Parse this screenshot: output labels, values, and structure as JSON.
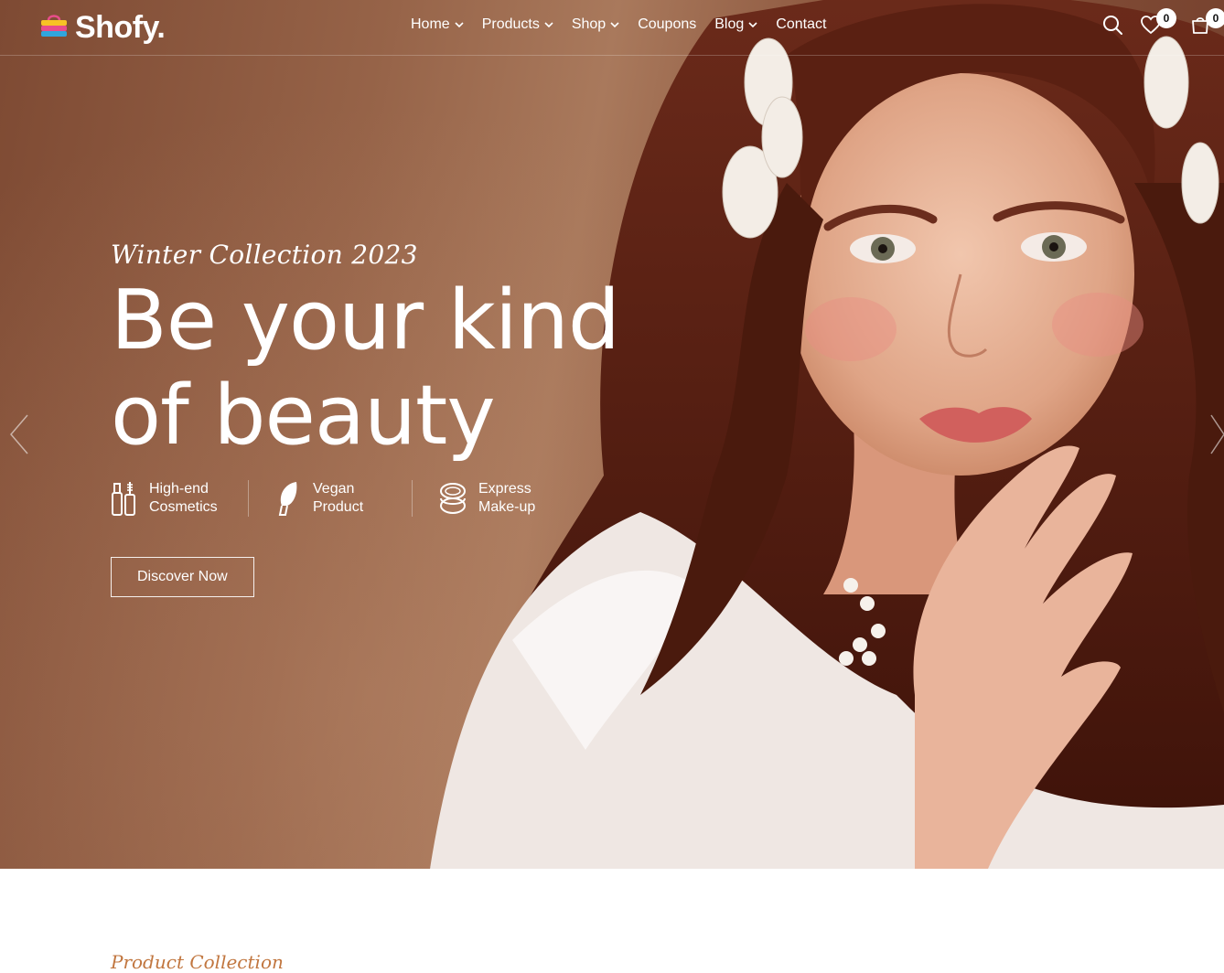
{
  "brand": {
    "name": "Shofy."
  },
  "nav": [
    {
      "label": "Home",
      "dropdown": true
    },
    {
      "label": "Products",
      "dropdown": true
    },
    {
      "label": "Shop",
      "dropdown": true
    },
    {
      "label": "Coupons",
      "dropdown": false
    },
    {
      "label": "Blog",
      "dropdown": true
    },
    {
      "label": "Contact",
      "dropdown": false
    }
  ],
  "header_icons": {
    "search": "search-icon",
    "wishlist_count": "0",
    "cart_count": "0"
  },
  "hero": {
    "subtitle": "Winter Collection 2023",
    "title_line1": "Be your kind",
    "title_line2": "of beauty",
    "features": [
      {
        "icon": "cosmetics-icon",
        "line1": "High-end",
        "line2": "Cosmetics"
      },
      {
        "icon": "vegan-product-icon",
        "line1": "Vegan",
        "line2": "Product"
      },
      {
        "icon": "makeup-compact-icon",
        "line1": "Express",
        "line2": "Make-up"
      }
    ],
    "cta": "Discover Now"
  },
  "below": {
    "section_heading": "Product Collection"
  },
  "colors": {
    "hero_bg": "#966348",
    "accent": "#c1763f"
  }
}
